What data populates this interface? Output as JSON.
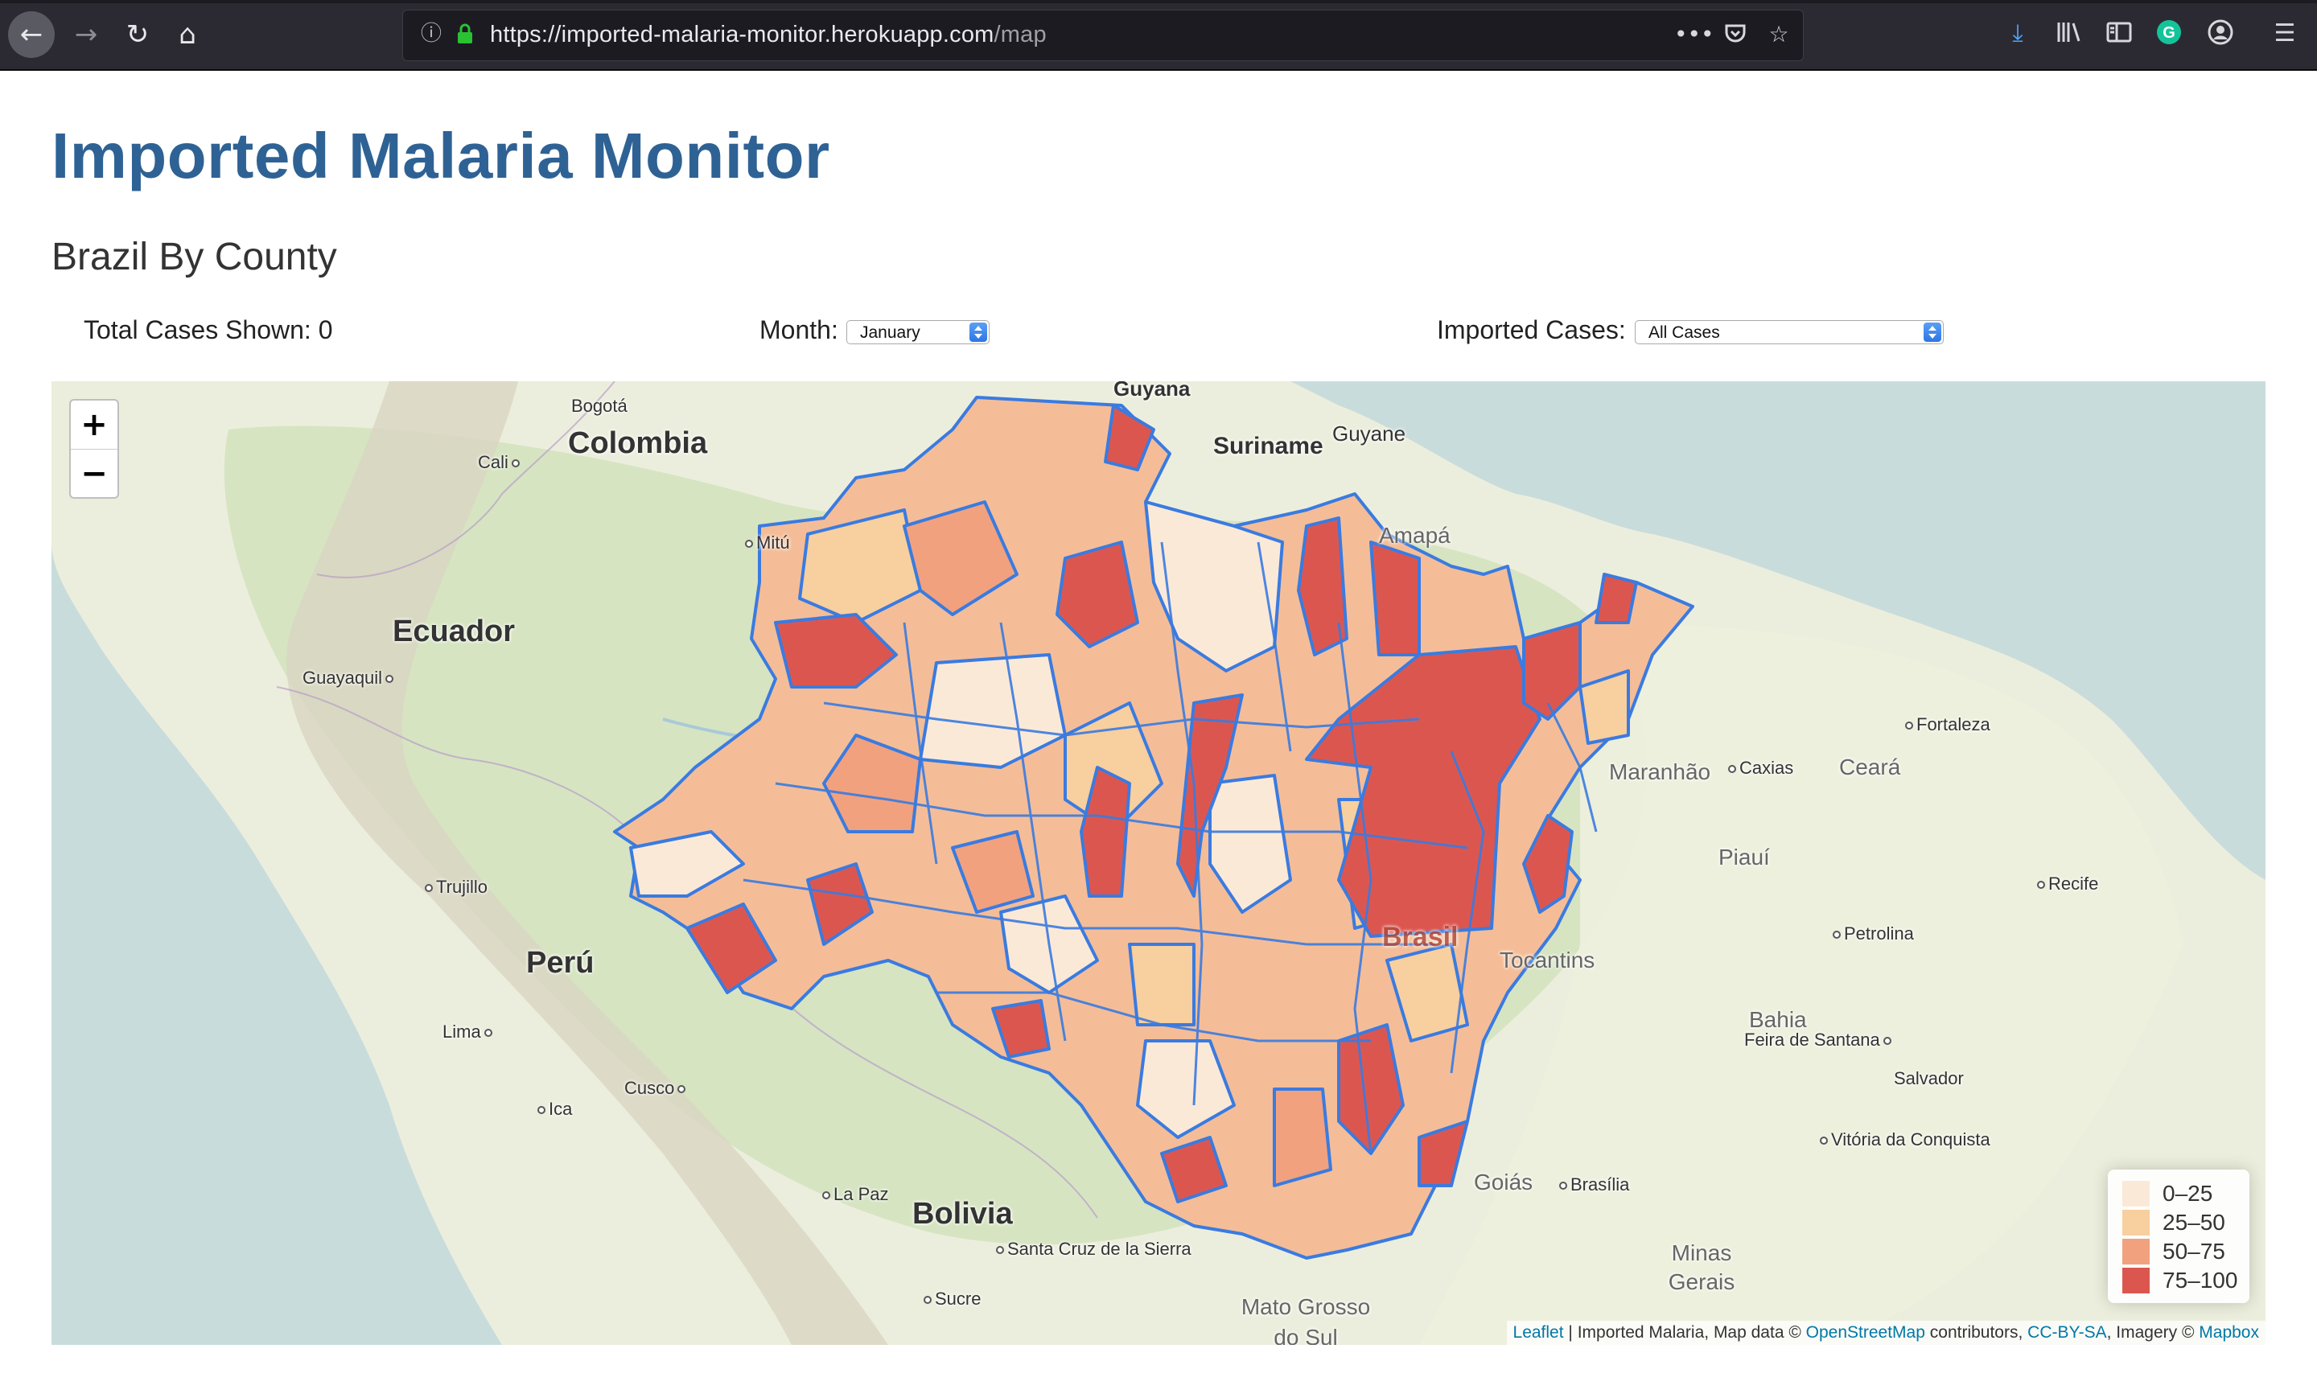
{
  "browser": {
    "url_host": "https://imported-malaria-monitor.herokuapp.com",
    "url_path": "/map"
  },
  "page": {
    "title": "Imported Malaria Monitor",
    "subtitle": "Brazil By County",
    "total_cases_label": "Total Cases Shown: 0",
    "month_label": "Month:",
    "month_value": "January",
    "imported_label": "Imported Cases:",
    "imported_value": "All Cases"
  },
  "map": {
    "zoom_in": "+",
    "zoom_out": "−",
    "labels": {
      "countries": [
        "Colombia",
        "Ecuador",
        "Perú",
        "Bolivia",
        "Suriname",
        "Guyane",
        "Guyana",
        "Brasil"
      ],
      "regions": [
        "Amapá",
        "Maranhão",
        "Ceará",
        "Piauí",
        "Tocantins",
        "Bahia",
        "Goiás",
        "Minas Gerais",
        "Mato Grosso do Sul"
      ],
      "cities": [
        "Bogotá",
        "Cali",
        "Mitú",
        "Guayaquil",
        "Trujillo",
        "Lima",
        "Cusco",
        "Ica",
        "La Paz",
        "Santa Cruz de la Sierra",
        "Sucre",
        "Fortaleza",
        "Caxias",
        "Recife",
        "Petrolina",
        "Feira de Santana",
        "Salvador",
        "Vitória da Conquista",
        "Brasília"
      ]
    },
    "legend": [
      {
        "label": "0–25",
        "color": "#fbe9d8"
      },
      {
        "label": "25–50",
        "color": "#f8cf9e"
      },
      {
        "label": "50–75",
        "color": "#f2a17e"
      },
      {
        "label": "75–100",
        "color": "#dc5650"
      }
    ],
    "boundary_color": "#3a7be0",
    "attribution": {
      "leaflet": "Leaflet",
      "text1": "| Imported Malaria, Map data ©",
      "osm": "OpenStreetMap",
      "text2": "contributors,",
      "license": "CC-BY-SA",
      "text3": ", Imagery ©",
      "mapbox": "Mapbox"
    }
  }
}
